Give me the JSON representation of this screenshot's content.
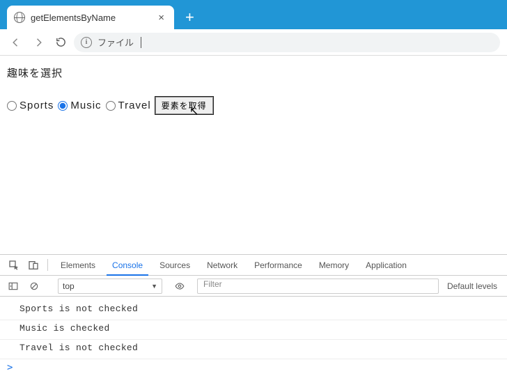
{
  "browser": {
    "tab_title": "getElementsByName",
    "url_label": "ファイル"
  },
  "page": {
    "heading": "趣味を選択",
    "options": [
      {
        "value": "sports",
        "label": "Sports",
        "checked": false
      },
      {
        "value": "music",
        "label": "Music",
        "checked": true
      },
      {
        "value": "travel",
        "label": "Travel",
        "checked": false
      }
    ],
    "button_label": "要素を取得"
  },
  "devtools": {
    "tabs": [
      "Elements",
      "Console",
      "Sources",
      "Network",
      "Performance",
      "Memory",
      "Application"
    ],
    "active_tab": "Console",
    "context": "top",
    "filter_placeholder": "Filter",
    "levels_label": "Default levels",
    "console_lines": [
      "Sports is not checked",
      "Music is checked",
      "Travel is not checked"
    ],
    "prompt": ">"
  }
}
